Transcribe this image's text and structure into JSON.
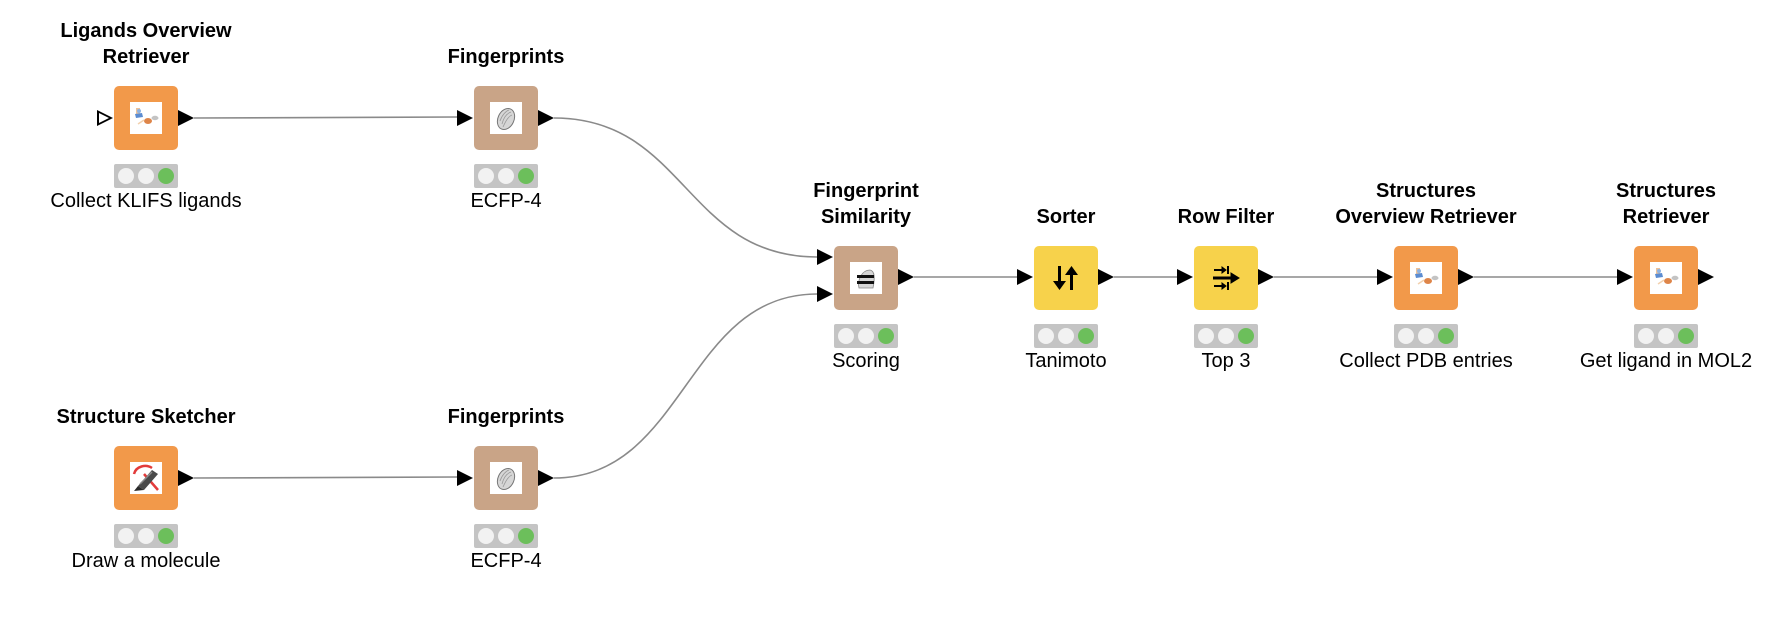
{
  "workflow": {
    "colors": {
      "source": "#F2994A",
      "manipulator": "#C9A487",
      "filter": "#F7D24B",
      "wire": "#8a8a8a",
      "status_bg": "#c4c4c4",
      "status_idle": "#f2f2f2",
      "status_executed": "#6cbf5b"
    },
    "nodes": [
      {
        "id": "n1",
        "title": "Ligands Overview Retriever",
        "description": "Collect KLIFS ligands",
        "type": "source",
        "icon": "molecule-retriever-icon",
        "status": "executed",
        "inputs": [
          "optional"
        ],
        "outputs": 1
      },
      {
        "id": "n2",
        "title": "Fingerprints",
        "description": "ECFP-4",
        "type": "manipulator",
        "icon": "fingerprint-icon",
        "status": "executed",
        "inputs": [
          "data"
        ],
        "outputs": 1
      },
      {
        "id": "n3",
        "title": "Structure Sketcher",
        "description": "Draw a molecule",
        "type": "source",
        "icon": "sketcher-pen-icon",
        "status": "executed",
        "inputs": [],
        "outputs": 1
      },
      {
        "id": "n4",
        "title": "Fingerprints",
        "description": "ECFP-4",
        "type": "manipulator",
        "icon": "fingerprint-icon",
        "status": "executed",
        "inputs": [
          "data"
        ],
        "outputs": 1
      },
      {
        "id": "n5",
        "title": "Fingerprint Similarity",
        "description": "Scoring",
        "type": "manipulator",
        "icon": "fingerprint-similarity-icon",
        "status": "executed",
        "inputs": [
          "data",
          "data"
        ],
        "outputs": 1
      },
      {
        "id": "n6",
        "title": "Sorter",
        "description": "Tanimoto",
        "type": "filter",
        "icon": "sort-arrows-icon",
        "status": "executed",
        "inputs": [
          "data"
        ],
        "outputs": 1
      },
      {
        "id": "n7",
        "title": "Row Filter",
        "description": "Top 3",
        "type": "filter",
        "icon": "row-filter-icon",
        "status": "executed",
        "inputs": [
          "data"
        ],
        "outputs": 1
      },
      {
        "id": "n8",
        "title": "Structures Overview Retriever",
        "description": "Collect PDB entries",
        "type": "source",
        "icon": "molecule-retriever-icon",
        "status": "executed",
        "inputs": [
          "data"
        ],
        "outputs": 1
      },
      {
        "id": "n9",
        "title": "Structures Retriever",
        "description": "Get ligand in MOL2",
        "type": "source",
        "icon": "molecule-retriever-icon",
        "status": "executed",
        "inputs": [
          "data"
        ],
        "outputs": 1
      }
    ],
    "titles_lines": {
      "n1": [
        "Ligands Overview",
        "Retriever"
      ],
      "n2": [
        "Fingerprints"
      ],
      "n3": [
        "Structure Sketcher"
      ],
      "n4": [
        "Fingerprints"
      ],
      "n5": [
        "Fingerprint",
        "Similarity"
      ],
      "n6": [
        "Sorter"
      ],
      "n7": [
        "Row Filter"
      ],
      "n8": [
        "Structures",
        "Overview Retriever"
      ],
      "n9": [
        "Structures",
        "Retriever"
      ]
    },
    "connections": [
      {
        "from": "n1",
        "to": "n2",
        "to_port": 0
      },
      {
        "from": "n2",
        "to": "n5",
        "to_port": 0
      },
      {
        "from": "n3",
        "to": "n4",
        "to_port": 0
      },
      {
        "from": "n4",
        "to": "n5",
        "to_port": 1
      },
      {
        "from": "n5",
        "to": "n6",
        "to_port": 0
      },
      {
        "from": "n6",
        "to": "n7",
        "to_port": 0
      },
      {
        "from": "n7",
        "to": "n8",
        "to_port": 0
      },
      {
        "from": "n8",
        "to": "n9",
        "to_port": 0
      }
    ]
  }
}
